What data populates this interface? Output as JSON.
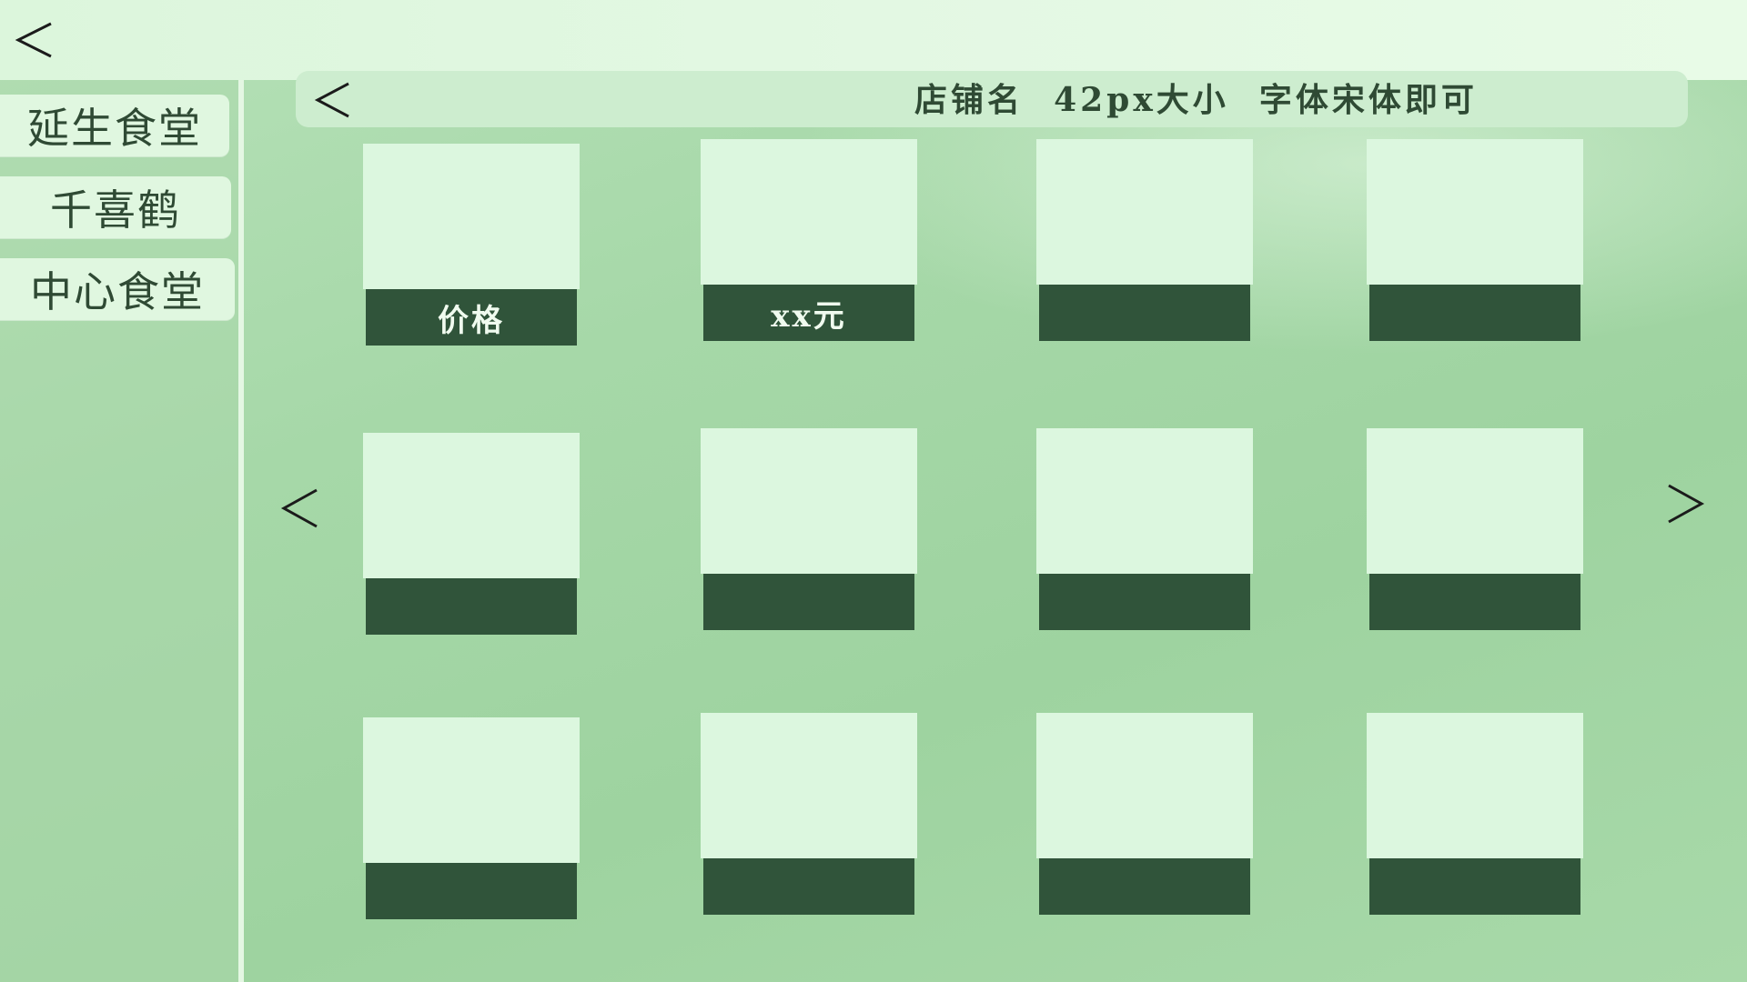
{
  "nav": {
    "back_icon": "chevron-left-icon"
  },
  "sidebar": {
    "items": [
      {
        "label": "延生食堂"
      },
      {
        "label": "千喜鹤"
      },
      {
        "label": "中心食堂"
      }
    ]
  },
  "store": {
    "back_icon": "chevron-left-icon",
    "name": "店铺名  42px大小  字体宋体即可"
  },
  "pager": {
    "prev_icon": "chevron-left-icon",
    "next_icon": "chevron-right-icon"
  },
  "items": [
    {
      "price": "价格"
    },
    {
      "price": "xx元"
    },
    {
      "price": ""
    },
    {
      "price": ""
    },
    {
      "price": ""
    },
    {
      "price": ""
    },
    {
      "price": ""
    },
    {
      "price": ""
    },
    {
      "price": ""
    },
    {
      "price": ""
    },
    {
      "price": ""
    },
    {
      "price": ""
    }
  ],
  "colors": {
    "topbar": "#dcf6dc",
    "canteen_button": "#e0f7e0",
    "header_bar": "#cdedcf",
    "card_image": "#dcf7df",
    "card_price_bar": "#30543a",
    "text": "#2f4a34"
  }
}
